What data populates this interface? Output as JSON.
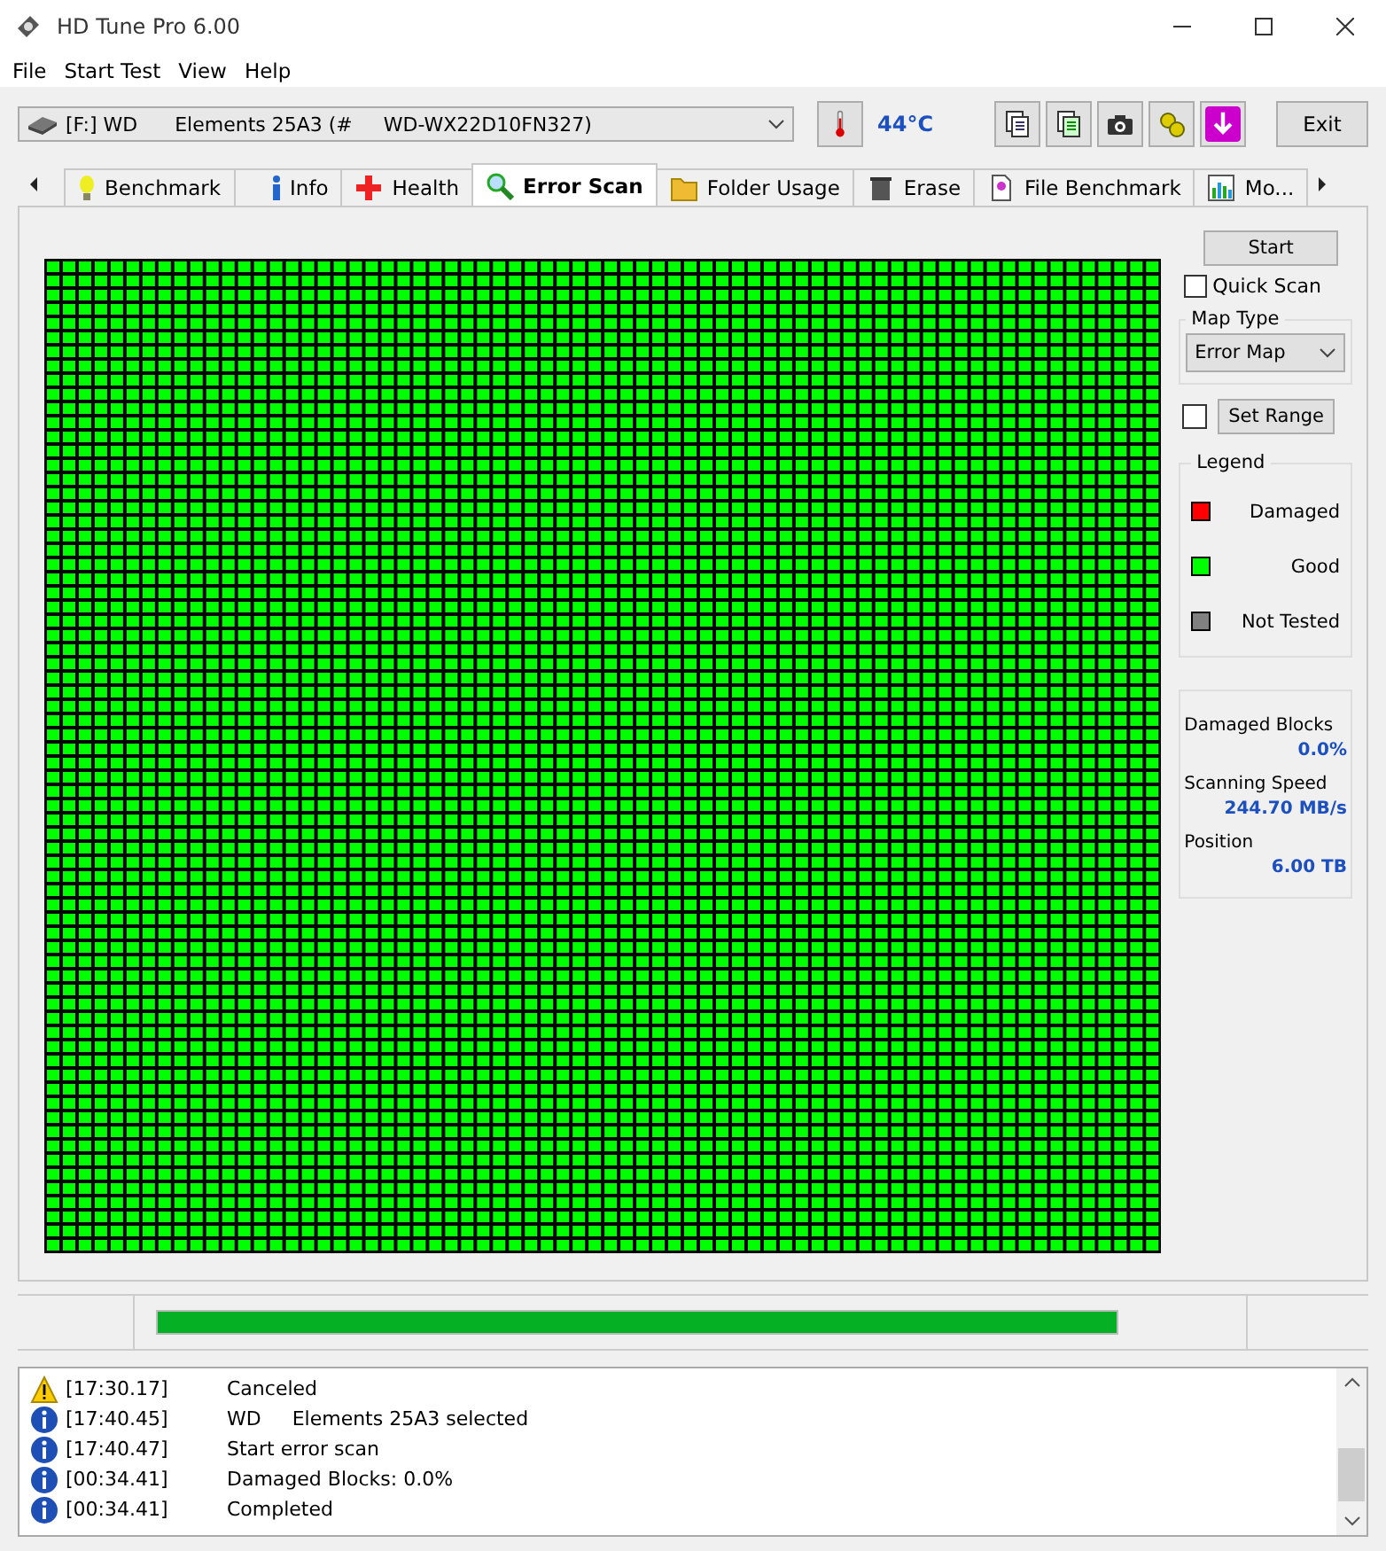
{
  "window": {
    "title": "HD Tune Pro 6.00"
  },
  "menu": [
    "File",
    "Start Test",
    "View",
    "Help"
  ],
  "drive_select": {
    "value": "[F:] WD      Elements 25A3 (#     WD-WX22D10FN327)"
  },
  "temperature": "44°C",
  "toolbar_buttons": [
    {
      "kind": "copy"
    },
    {
      "kind": "copy-all"
    },
    {
      "kind": "camera"
    },
    {
      "kind": "options"
    },
    {
      "kind": "save"
    }
  ],
  "exit_button": "Exit",
  "tabs": [
    {
      "label": "Benchmark",
      "kind": "bulb",
      "selected": false
    },
    {
      "label": "Info",
      "kind": "info",
      "selected": false
    },
    {
      "label": "Health",
      "kind": "health",
      "selected": false
    },
    {
      "label": "Error Scan",
      "kind": "search",
      "selected": true
    },
    {
      "label": "Folder Usage",
      "kind": "folder",
      "selected": false
    },
    {
      "label": "Erase",
      "kind": "trash",
      "selected": false
    },
    {
      "label": "File Benchmark",
      "kind": "file",
      "selected": false
    },
    {
      "label": "Mo...",
      "kind": "chart",
      "selected": false
    }
  ],
  "start_button": "Start",
  "quick_scan": {
    "label": "Quick Scan",
    "checked": false
  },
  "map_type": {
    "label": "Map Type",
    "value": "Error Map"
  },
  "set_range": {
    "label": "Set Range",
    "checked": false
  },
  "legend": {
    "title": "Legend",
    "items": [
      {
        "label": "Damaged",
        "kind": "damaged",
        "color": "#ff0000"
      },
      {
        "label": "Good",
        "kind": "good",
        "color": "#00ff00"
      },
      {
        "label": "Not Tested",
        "kind": "untested",
        "color": "#808080"
      }
    ]
  },
  "stats": [
    {
      "label": "Damaged Blocks",
      "value": "0.0%"
    },
    {
      "label": "Scanning Speed",
      "value": "244.70 MB/s"
    },
    {
      "label": "Position",
      "value": "6.00 TB"
    }
  ],
  "progress": {
    "level": 1
  },
  "log": [
    {
      "kind": "warning",
      "time": "[17:30.17]",
      "message": "Canceled"
    },
    {
      "kind": "info",
      "time": "[17:40.45]",
      "message": "WD     Elements 25A3 selected"
    },
    {
      "kind": "info",
      "time": "[17:40.47]",
      "message": "Start error scan"
    },
    {
      "kind": "info",
      "time": "[00:34.41]",
      "message": "Damaged Blocks: 0.0%"
    },
    {
      "kind": "info",
      "time": "[00:34.41]",
      "message": "Completed"
    }
  ]
}
